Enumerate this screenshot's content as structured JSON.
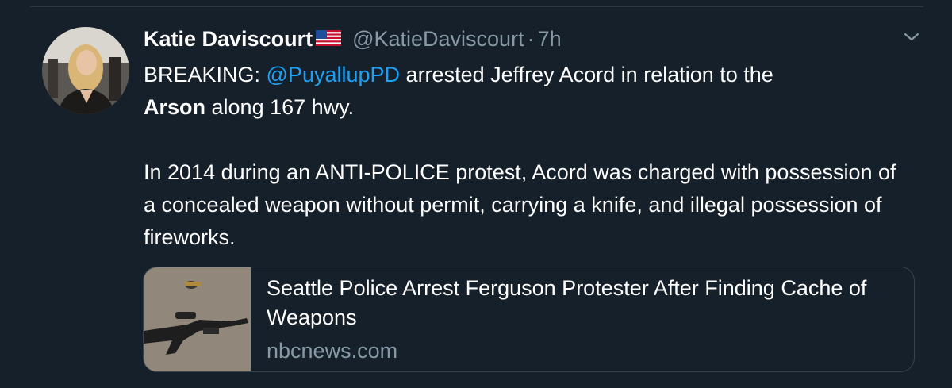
{
  "tweet": {
    "author_name": "Katie Daviscourt",
    "author_flag_icon": "us-flag-icon",
    "handle": "@KatieDaviscourt",
    "separator": "·",
    "time": "7h",
    "lines": {
      "l1_prefix": "BREAKING: ",
      "l1_mention": "@PuyallupPD",
      "l1_suffix": " arrested Jeffrey Acord in relation to the",
      "l2_bold": "Arson",
      "l2_suffix": " along 167 hwy.",
      "p2": "In 2014 during an ANTI-POLICE protest, Acord was charged with possession of a concealed weapon without permit, carrying a knife, and illegal possession of fireworks."
    },
    "card": {
      "title": "Seattle Police Arrest Ferguson Protester After Finding Cache of Weapons",
      "domain": "nbcnews.com"
    }
  },
  "colors": {
    "background": "#15202b",
    "mention": "#1da1f2",
    "secondary_text": "#8899a6"
  }
}
